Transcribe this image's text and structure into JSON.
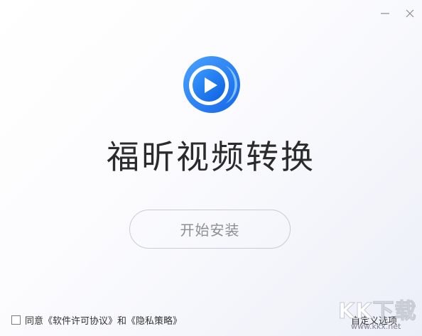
{
  "window": {
    "background_start": "#ffffff",
    "background_end": "#eceff8"
  },
  "controls": {
    "minimize_icon": "minimize-icon",
    "close_icon": "close-icon"
  },
  "app": {
    "logo_icon": "play-logo-icon",
    "name": "福昕视频转换",
    "accent_color": "#1f7cf2"
  },
  "install_button": {
    "label": "开始安装"
  },
  "agreement": {
    "checked": false,
    "prefix": "同意",
    "license_link": "《软件许可协议》",
    "conjunction": "和",
    "privacy_link": "《隐私策略》"
  },
  "custom_options": {
    "label": "自定义选项"
  },
  "watermark": {
    "logo_text": "KK下载",
    "url": "www.kkx.net"
  }
}
